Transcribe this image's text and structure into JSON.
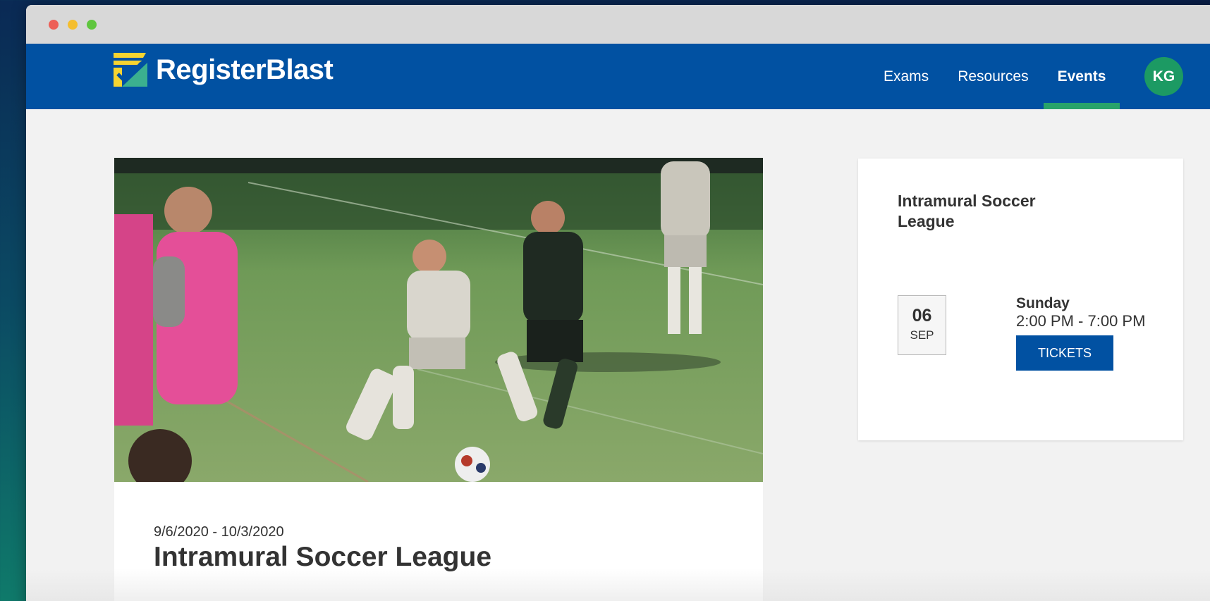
{
  "brand": {
    "name": "RegisterBlast"
  },
  "nav": {
    "items": [
      {
        "label": "Exams"
      },
      {
        "label": "Resources"
      },
      {
        "label": "Events"
      }
    ],
    "active": "Events",
    "avatar_initials": "KG"
  },
  "event": {
    "date_range": "9/6/2020 - 10/3/2020",
    "title": "Intramural Soccer League",
    "image": "soccer-match-photo"
  },
  "sidebar_card": {
    "title": "Intramural Soccer League",
    "day": "06",
    "month": "SEP",
    "weekday": "Sunday",
    "time": "2:00 PM - 7:00 PM",
    "tickets_label": "TICKETS"
  },
  "colors": {
    "navbar": "#0151a2",
    "accent_green": "#28a36a",
    "avatar": "#1c9a63"
  }
}
